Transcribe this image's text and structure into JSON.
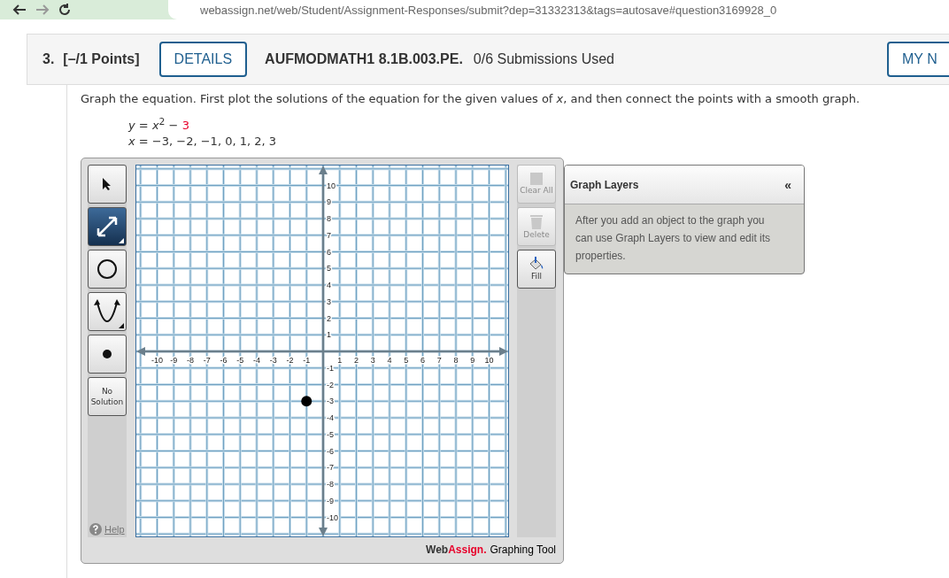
{
  "browser": {
    "url": "webassign.net/web/Student/Assignment-Responses/submit?dep=31332313&tags=autosave#question3169928_0"
  },
  "question": {
    "number": "3.",
    "points": "[–/1 Points]",
    "details_button": "DETAILS",
    "code": "AUFMODMATH1 8.1B.003.PE.",
    "submissions": "0/6 Submissions Used",
    "right_button": "MY N"
  },
  "instructions": "Graph the equation. First plot the solutions of the equation for the given values of *x*, and then connect the points with a smooth graph.",
  "equations": [
    {
      "text": "*y* = *x*$^{2}$ −",
      "highlight": "3"
    },
    {
      "text": "*x* = −3, −2, −1, 0, 1, 2, 3"
    }
  ],
  "graphing_tool": {
    "tools": [
      {
        "kind": "pointer",
        "selected": false
      },
      {
        "kind": "line",
        "selected": true
      },
      {
        "kind": "circle",
        "selected": false
      },
      {
        "kind": "parabola",
        "selected": false
      },
      {
        "kind": "point",
        "selected": false
      },
      {
        "kind": "no_solution",
        "label": "No Solution",
        "selected": false
      }
    ],
    "help": "Help",
    "graph": {
      "chart_data": {
        "type": "scatter",
        "xlim": [
          -10,
          10
        ],
        "ylim": [
          -10,
          10
        ],
        "xticks": [
          -10,
          -9,
          -8,
          -7,
          -6,
          -5,
          -4,
          -3,
          -2,
          -1,
          1,
          2,
          3,
          4,
          5,
          6,
          7,
          8,
          9,
          10
        ],
        "yticks": [
          -10,
          -9,
          -8,
          -7,
          -6,
          -5,
          -4,
          -3,
          -2,
          -1,
          1,
          2,
          3,
          4,
          5,
          6,
          7,
          8,
          9,
          10
        ],
        "x": [
          -1
        ],
        "grid": true,
        "series": [
          {
            "color": "#000000",
            "values": [
              -3
            ]
          }
        ]
      }
    },
    "actions": [
      {
        "kind": "clear",
        "label": "Clear All",
        "disabled": true
      },
      {
        "kind": "delete",
        "label": "Delete",
        "disabled": true
      },
      {
        "kind": "fill",
        "label": "Fill",
        "disabled": false
      }
    ],
    "logo": "Web",
    "logo_accent": "Assign.",
    "caption": "Graphing Tool"
  },
  "layers_panel": {
    "title": "Graph Layers",
    "collapse": "«",
    "message": "After you add an object to the graph you can use Graph Layers to view and edit its properties."
  }
}
